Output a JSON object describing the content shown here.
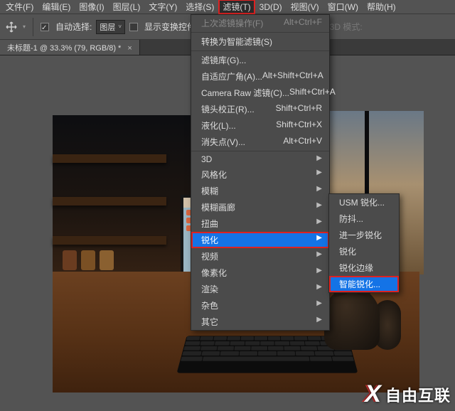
{
  "menubar": [
    {
      "label": "文件(F)"
    },
    {
      "label": "编辑(E)"
    },
    {
      "label": "图像(I)"
    },
    {
      "label": "图层(L)"
    },
    {
      "label": "文字(Y)"
    },
    {
      "label": "选择(S)"
    },
    {
      "label": "滤镜(T)",
      "active": true,
      "highlight": true
    },
    {
      "label": "3D(D)"
    },
    {
      "label": "视图(V)"
    },
    {
      "label": "窗口(W)"
    },
    {
      "label": "帮助(H)"
    }
  ],
  "options": {
    "auto_select": "自动选择:",
    "layer_dd": "图层",
    "show_transform": "显示变换控件",
    "mode_label": "3D 模式:"
  },
  "tab": {
    "title": "未标题-1 @ 33.3% (79, RGB/8) *"
  },
  "filter_menu": [
    {
      "label": "上次滤镜操作(F)",
      "shortcut": "Alt+Ctrl+F",
      "disabled": true
    },
    {
      "sep": true
    },
    {
      "label": "转换为智能滤镜(S)"
    },
    {
      "sep": true
    },
    {
      "label": "滤镜库(G)..."
    },
    {
      "label": "自适应广角(A)...",
      "shortcut": "Alt+Shift+Ctrl+A"
    },
    {
      "label": "Camera Raw 滤镜(C)...",
      "shortcut": "Shift+Ctrl+A"
    },
    {
      "label": "镜头校正(R)...",
      "shortcut": "Shift+Ctrl+R"
    },
    {
      "label": "液化(L)...",
      "shortcut": "Shift+Ctrl+X"
    },
    {
      "label": "消失点(V)...",
      "shortcut": "Alt+Ctrl+V"
    },
    {
      "sep": true
    },
    {
      "label": "3D",
      "arrow": true
    },
    {
      "label": "风格化",
      "arrow": true
    },
    {
      "label": "模糊",
      "arrow": true
    },
    {
      "label": "模糊画廊",
      "arrow": true
    },
    {
      "label": "扭曲",
      "arrow": true
    },
    {
      "label": "锐化",
      "arrow": true,
      "active": true,
      "highlight": true
    },
    {
      "label": "视频",
      "arrow": true
    },
    {
      "label": "像素化",
      "arrow": true
    },
    {
      "label": "渲染",
      "arrow": true
    },
    {
      "label": "杂色",
      "arrow": true
    },
    {
      "label": "其它",
      "arrow": true
    }
  ],
  "sharpen_submenu": [
    {
      "label": "USM 锐化..."
    },
    {
      "label": "防抖..."
    },
    {
      "label": "进一步锐化"
    },
    {
      "label": "锐化"
    },
    {
      "label": "锐化边缘"
    },
    {
      "label": "智能锐化...",
      "active": true,
      "highlight": true
    }
  ],
  "watermark": {
    "logo": "X",
    "text": "自由互联"
  }
}
